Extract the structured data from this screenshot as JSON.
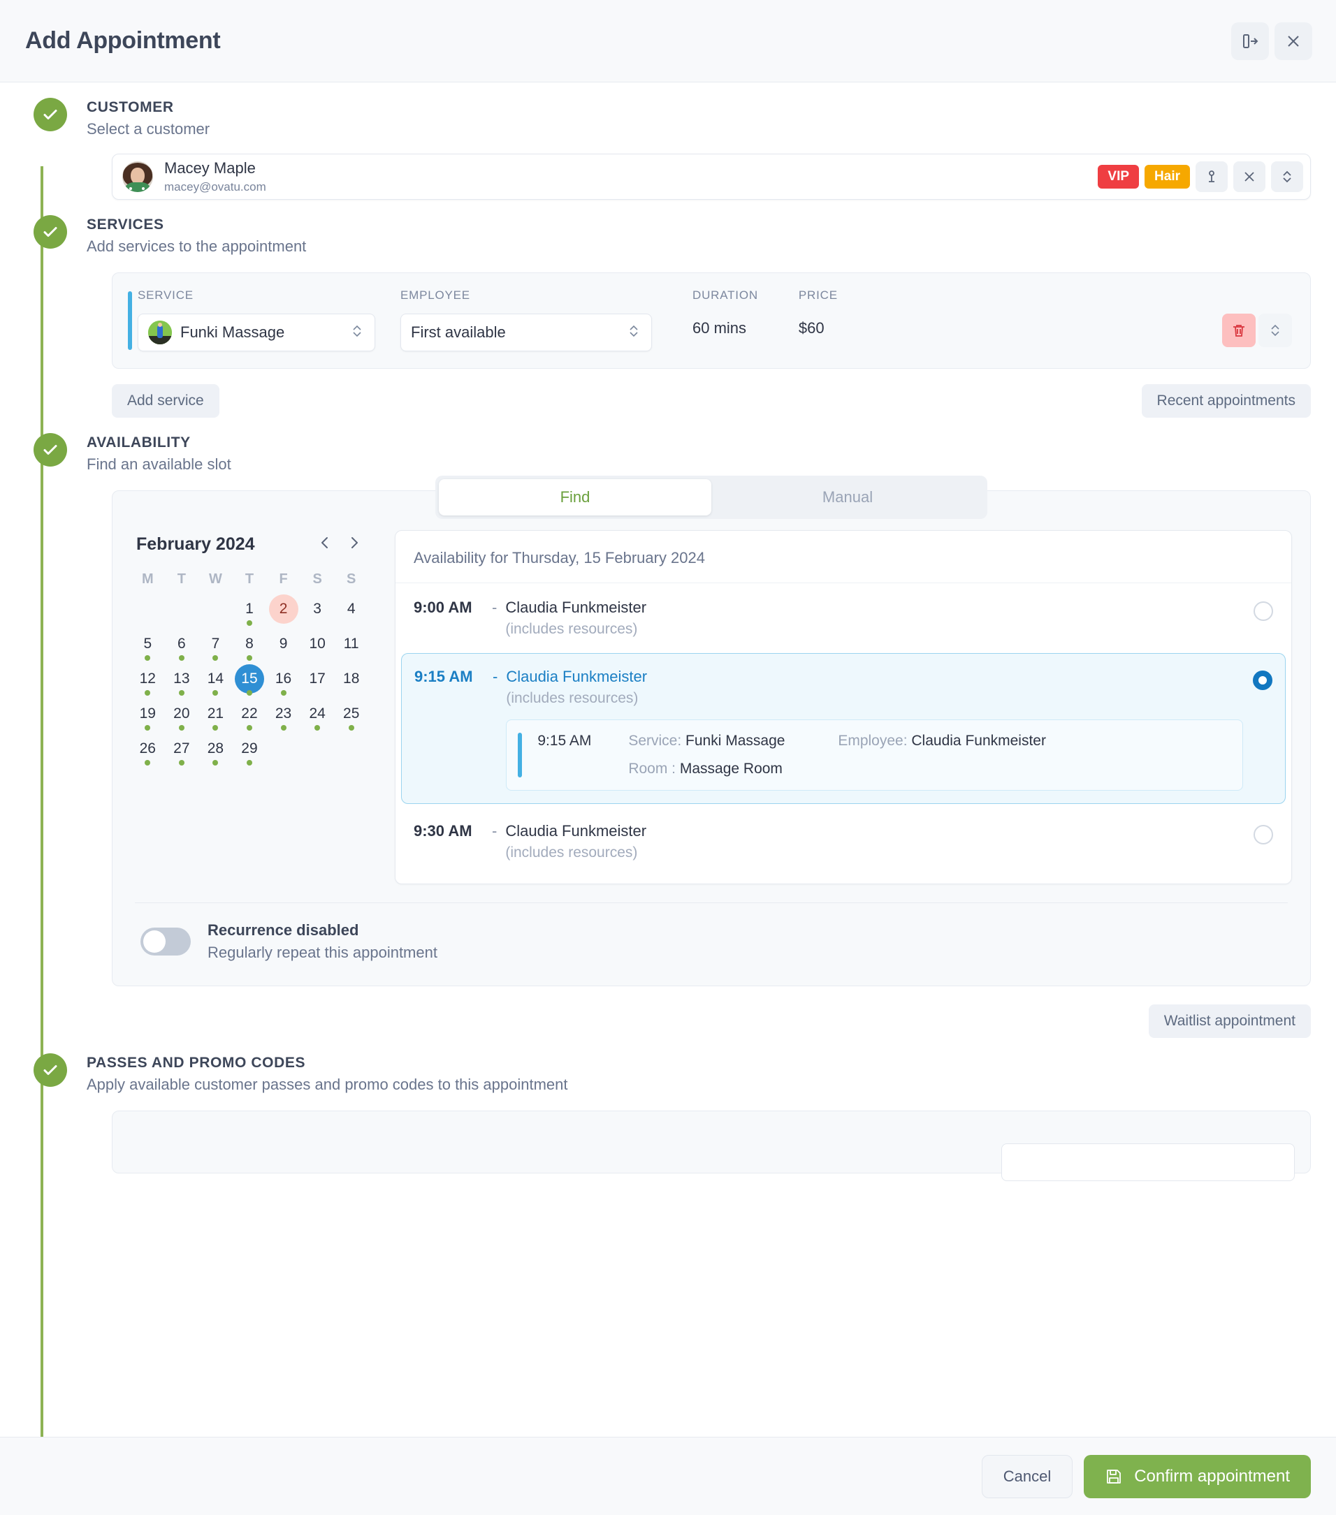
{
  "header": {
    "title": "Add Appointment",
    "expand_icon": "expand-panel-icon",
    "close_icon": "close-icon"
  },
  "sections": {
    "customer": {
      "title": "CUSTOMER",
      "subtitle": "Select a customer",
      "selected": {
        "name": "Macey Maple",
        "email": "macey@ovatu.com",
        "tags": [
          {
            "label": "VIP",
            "color": "#ef3e42"
          },
          {
            "label": "Hair",
            "color": "#f6a800"
          }
        ]
      }
    },
    "services": {
      "title": "SERVICES",
      "subtitle": "Add services to the appointment",
      "columns": {
        "service": "SERVICE",
        "employee": "EMPLOYEE",
        "duration": "DURATION",
        "price": "PRICE"
      },
      "row": {
        "service": "Funki Massage",
        "employee": "First available",
        "duration": "60 mins",
        "price": "$60"
      },
      "add_service_label": "Add service",
      "recent_appointments_label": "Recent appointments"
    },
    "availability": {
      "title": "AVAILABILITY",
      "subtitle": "Find an available slot",
      "tabs": [
        {
          "label": "Find",
          "active": true
        },
        {
          "label": "Manual",
          "active": false
        }
      ],
      "calendar": {
        "month_label": "February 2024",
        "prev_icon": "chevron-left-icon",
        "next_icon": "chevron-right-icon",
        "weekdays": [
          "M",
          "T",
          "W",
          "T",
          "F",
          "S",
          "S"
        ],
        "lead_blanks": 3,
        "days": [
          {
            "n": 1,
            "dot": true
          },
          {
            "n": 2,
            "dot": false,
            "today": true
          },
          {
            "n": 3,
            "dot": false
          },
          {
            "n": 4,
            "dot": false
          },
          {
            "n": 5,
            "dot": true
          },
          {
            "n": 6,
            "dot": true
          },
          {
            "n": 7,
            "dot": true
          },
          {
            "n": 8,
            "dot": true
          },
          {
            "n": 9,
            "dot": false
          },
          {
            "n": 10,
            "dot": false
          },
          {
            "n": 11,
            "dot": false
          },
          {
            "n": 12,
            "dot": true
          },
          {
            "n": 13,
            "dot": true
          },
          {
            "n": 14,
            "dot": true
          },
          {
            "n": 15,
            "dot": true,
            "selected": true
          },
          {
            "n": 16,
            "dot": true
          },
          {
            "n": 17,
            "dot": false
          },
          {
            "n": 18,
            "dot": false
          },
          {
            "n": 19,
            "dot": true
          },
          {
            "n": 20,
            "dot": true
          },
          {
            "n": 21,
            "dot": true
          },
          {
            "n": 22,
            "dot": true
          },
          {
            "n": 23,
            "dot": true
          },
          {
            "n": 24,
            "dot": true
          },
          {
            "n": 25,
            "dot": true
          },
          {
            "n": 26,
            "dot": true
          },
          {
            "n": 27,
            "dot": true
          },
          {
            "n": 28,
            "dot": true
          },
          {
            "n": 29,
            "dot": true
          }
        ]
      },
      "slots_header": "Availability for Thursday, 15 February 2024",
      "slots": [
        {
          "time": "9:00 AM",
          "dash": "-",
          "employee": "Claudia Funkmeister",
          "resources_note": "(includes resources)",
          "selected": false
        },
        {
          "time": "9:15 AM",
          "dash": "-",
          "employee": "Claudia Funkmeister",
          "resources_note": "(includes resources)",
          "selected": true,
          "detail": {
            "time": "9:15 AM",
            "service_key": "Service:",
            "service_value": "Funki Massage",
            "employee_key": "Employee:",
            "employee_value": "Claudia Funkmeister",
            "room_key": "Room :",
            "room_value": "Massage Room"
          }
        },
        {
          "time": "9:30 AM",
          "dash": "-",
          "employee": "Claudia Funkmeister",
          "resources_note": "(includes resources)",
          "selected": false
        }
      ],
      "recurrence": {
        "title": "Recurrence disabled",
        "subtitle": "Regularly repeat this appointment",
        "enabled": false
      },
      "waitlist_label": "Waitlist appointment"
    },
    "passes": {
      "title": "PASSES AND PROMO CODES",
      "subtitle": "Apply available customer passes and promo codes to this appointment"
    }
  },
  "footer": {
    "cancel_label": "Cancel",
    "confirm_label": "Confirm appointment",
    "confirm_icon": "save-icon"
  },
  "colors": {
    "step_green": "#7aa843",
    "confirm_green": "#7fb24e",
    "selected_blue": "#2f8fd4",
    "radio_blue": "#1277c0",
    "accent_cyan": "#44b0e3",
    "tag_vip": "#ef3e42",
    "tag_hair": "#f6a800",
    "today_pink": "#fcd3cc",
    "day_dot_green": "#7fb04a"
  }
}
